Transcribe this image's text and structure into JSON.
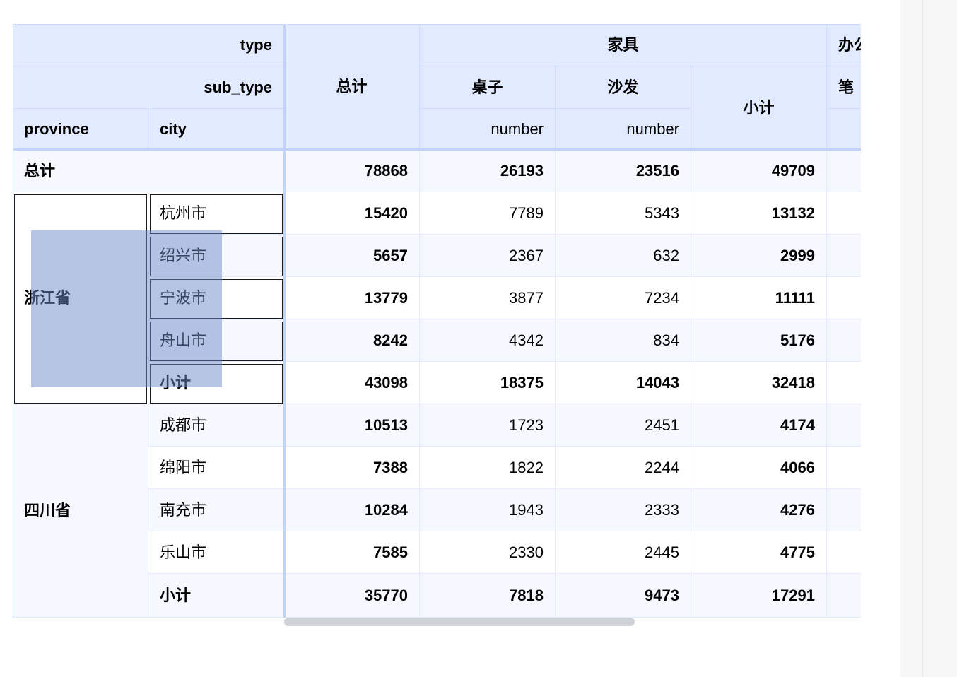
{
  "header": {
    "type_label": "type",
    "sub_type_label": "sub_type",
    "province_label": "province",
    "city_label": "city",
    "grand_total": "总计",
    "furniture": "家具",
    "desk": "桌子",
    "sofa": "沙发",
    "subtotal": "小计",
    "office": "办公",
    "pen": "笔",
    "number": "number"
  },
  "totals_row": {
    "label": "总计",
    "values": [
      "78868",
      "26193",
      "23516",
      "49709"
    ]
  },
  "provinces": [
    {
      "name": "浙江省",
      "rows": [
        {
          "city": "杭州市",
          "values": [
            "15420",
            "7789",
            "5343",
            "13132"
          ]
        },
        {
          "city": "绍兴市",
          "values": [
            "5657",
            "2367",
            "632",
            "2999"
          ]
        },
        {
          "city": "宁波市",
          "values": [
            "13779",
            "3877",
            "7234",
            "11111"
          ]
        },
        {
          "city": "舟山市",
          "values": [
            "8242",
            "4342",
            "834",
            "5176"
          ]
        },
        {
          "city": "小计",
          "values": [
            "43098",
            "18375",
            "14043",
            "32418"
          ]
        }
      ]
    },
    {
      "name": "四川省",
      "rows": [
        {
          "city": "成都市",
          "values": [
            "10513",
            "1723",
            "2451",
            "4174"
          ]
        },
        {
          "city": "绵阳市",
          "values": [
            "7388",
            "1822",
            "2244",
            "4066"
          ]
        },
        {
          "city": "南充市",
          "values": [
            "10284",
            "1943",
            "2333",
            "4276"
          ]
        },
        {
          "city": "乐山市",
          "values": [
            "7585",
            "2330",
            "2445",
            "4775"
          ]
        },
        {
          "city": "小计",
          "values": [
            "35770",
            "7818",
            "9473",
            "17291"
          ]
        }
      ]
    }
  ]
}
